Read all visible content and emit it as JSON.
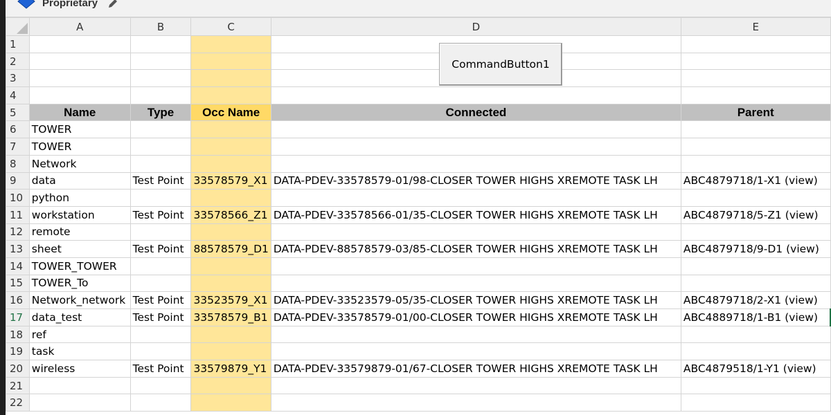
{
  "infobar": {
    "label_text": "Proprietary",
    "colors": {
      "label_icon": "#1f63d6",
      "infobar_bg": "#f2f2f2"
    }
  },
  "sheet": {
    "columns": [
      "A",
      "B",
      "C",
      "D",
      "E"
    ],
    "rows": [
      {
        "num": "1",
        "cells": [
          "",
          "",
          "",
          "",
          ""
        ]
      },
      {
        "num": "2",
        "cells": [
          "",
          "",
          "",
          "",
          ""
        ]
      },
      {
        "num": "3",
        "cells": [
          "",
          "",
          "",
          "",
          ""
        ]
      },
      {
        "num": "4",
        "cells": [
          "",
          "",
          "",
          "",
          ""
        ]
      },
      {
        "num": "5",
        "cells": [
          "Name",
          "Type",
          "Occ Name",
          "Connected",
          "Parent"
        ],
        "header": true
      },
      {
        "num": "6",
        "cells": [
          "TOWER",
          "",
          "",
          "",
          ""
        ]
      },
      {
        "num": "7",
        "cells": [
          "TOWER",
          "",
          "",
          "",
          ""
        ]
      },
      {
        "num": "8",
        "cells": [
          "Network",
          "",
          "",
          "",
          ""
        ]
      },
      {
        "num": "9",
        "cells": [
          "data",
          "Test Point",
          "33578579_X1",
          "DATA-PDEV-33578579-01/98-CLOSER TOWER HIGHS XREMOTE TASK LH",
          "ABC4879718/1-X1 (view)"
        ]
      },
      {
        "num": "10",
        "cells": [
          "python",
          "",
          "",
          "",
          ""
        ]
      },
      {
        "num": "11",
        "cells": [
          "workstation",
          "Test Point",
          "33578566_Z1",
          "DATA-PDEV-33578566-01/35-CLOSER TOWER HIGHS XREMOTE TASK LH",
          "ABC4879718/5-Z1 (view)"
        ]
      },
      {
        "num": "12",
        "cells": [
          "remote",
          "",
          "",
          "",
          ""
        ]
      },
      {
        "num": "13",
        "cells": [
          "sheet",
          "Test Point",
          "88578579_D1",
          "DATA-PDEV-88578579-03/85-CLOSER TOWER HIGHS XREMOTE TASK LH",
          "ABC4879718/9-D1 (view)"
        ]
      },
      {
        "num": "14",
        "cells": [
          "TOWER_TOWER",
          "",
          "",
          "",
          ""
        ]
      },
      {
        "num": "15",
        "cells": [
          "TOWER_To",
          "",
          "",
          "",
          ""
        ]
      },
      {
        "num": "16",
        "cells": [
          "Network_network",
          "Test Point",
          "33523579_X1",
          "DATA-PDEV-33523579-05/35-CLOSER TOWER HIGHS XREMOTE TASK LH",
          "ABC4879718/2-X1 (view)"
        ]
      },
      {
        "num": "17",
        "cells": [
          "data_test",
          "Test Point",
          "33578579_B1",
          "DATA-PDEV-33578579-01/00-CLOSER TOWER HIGHS XREMOTE TASK LH",
          "ABC4889718/1-B1 (view)"
        ],
        "selected": true
      },
      {
        "num": "18",
        "cells": [
          "ref",
          "",
          "",
          "",
          ""
        ]
      },
      {
        "num": "19",
        "cells": [
          "task",
          "",
          "",
          "",
          ""
        ]
      },
      {
        "num": "20",
        "cells": [
          "wireless",
          "Test Point",
          "33579879_Y1",
          "DATA-PDEV-33579879-01/67-CLOSER TOWER HIGHS XREMOTE TASK LH",
          "ABC4879518/1-Y1 (view)"
        ]
      },
      {
        "num": "21",
        "cells": [
          "",
          "",
          "",
          "",
          ""
        ]
      },
      {
        "num": "22",
        "cells": [
          "",
          "",
          "",
          "",
          ""
        ]
      }
    ],
    "colors": {
      "header_row_bg": "#c0c0c0",
      "occ_header_bg": "#ffd966",
      "occ_column_bg": "#ffe699",
      "selection": "#217346"
    }
  },
  "command_button": {
    "label": "CommandButton1"
  }
}
